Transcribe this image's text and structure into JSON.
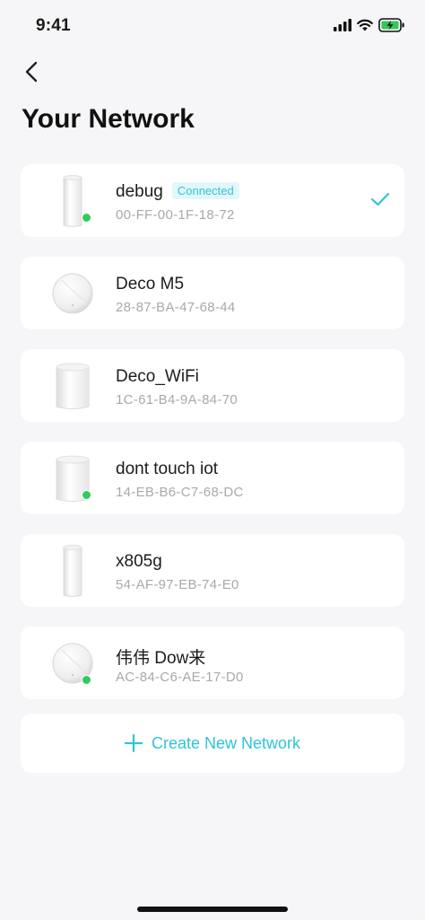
{
  "status_bar": {
    "time": "9:41"
  },
  "header": {
    "title": "Your Network"
  },
  "networks": [
    {
      "name": "debug",
      "mac": "00-FF-00-1F-18-72",
      "badge": "Connected",
      "online": true,
      "selected": true,
      "device_icon": "tower-icon"
    },
    {
      "name": "Deco M5",
      "mac": "28-87-BA-47-68-44",
      "online": false,
      "device_icon": "disc-icon"
    },
    {
      "name": "Deco_WiFi",
      "mac": "1C-61-B4-9A-84-70",
      "online": false,
      "device_icon": "cube-icon"
    },
    {
      "name": "dont touch iot",
      "mac": "14-EB-B6-C7-68-DC",
      "online": true,
      "device_icon": "cube-icon"
    },
    {
      "name": "x805g",
      "mac": "54-AF-97-EB-74-E0",
      "online": false,
      "device_icon": "tower-icon"
    },
    {
      "name": "伟伟 Dow来",
      "mac": "AC-84-C6-AE-17-D0",
      "online": true,
      "device_icon": "disc-icon"
    }
  ],
  "create_button": {
    "label": "Create New Network"
  },
  "colors": {
    "accent": "#2ec4d7",
    "online": "#2ecb5c",
    "background": "#f6f6f8"
  }
}
